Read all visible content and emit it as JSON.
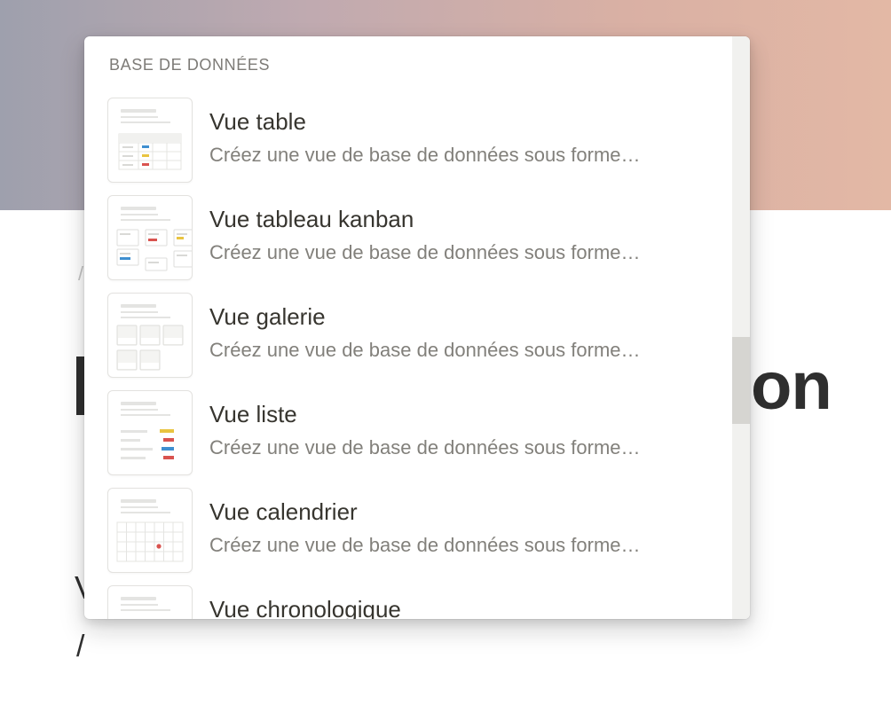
{
  "page": {
    "slash_hint": "/",
    "title_tail": "on",
    "letter": "V",
    "slash": "/"
  },
  "menu": {
    "section_header": "BASE DE DONNÉES",
    "items": [
      {
        "title": "Vue table",
        "description": "Créez une vue de base de données sous forme…",
        "icon": "table-view-icon"
      },
      {
        "title": "Vue tableau kanban",
        "description": "Créez une vue de base de données sous forme…",
        "icon": "kanban-board-icon"
      },
      {
        "title": "Vue galerie",
        "description": "Créez une vue de base de données sous forme…",
        "icon": "gallery-view-icon"
      },
      {
        "title": "Vue liste",
        "description": "Créez une vue de base de données sous forme…",
        "icon": "list-view-icon"
      },
      {
        "title": "Vue calendrier",
        "description": "Créez une vue de base de données sous forme…",
        "icon": "calendar-view-icon"
      },
      {
        "title": "Vue chronologique",
        "description": "",
        "icon": "timeline-view-icon"
      }
    ]
  },
  "colors": {
    "accent_yellow": "#e9c440",
    "accent_red": "#d9534f",
    "accent_blue": "#3f8fd0",
    "placeholder_gray": "#e4e4e2"
  }
}
